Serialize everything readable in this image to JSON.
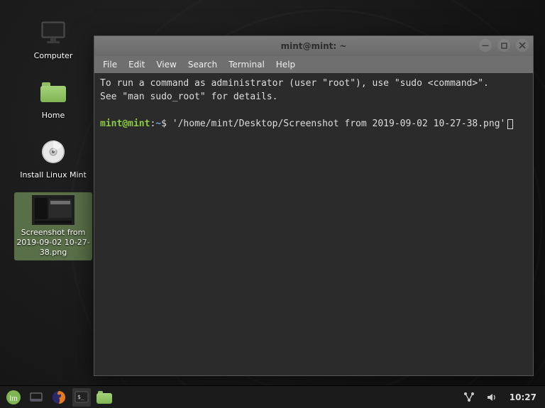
{
  "desktop": {
    "icons": [
      {
        "name": "computer",
        "label": "Computer"
      },
      {
        "name": "home",
        "label": "Home"
      },
      {
        "name": "install",
        "label": "Install Linux Mint"
      },
      {
        "name": "screenshot",
        "label": "Screenshot from 2019-09-02 10-27-38.png",
        "selected": true
      }
    ]
  },
  "terminal": {
    "title": "mint@mint: ~",
    "menu": [
      "File",
      "Edit",
      "View",
      "Search",
      "Terminal",
      "Help"
    ],
    "motd_line1": "To run a command as administrator (user \"root\"), use \"sudo <command>\".",
    "motd_line2": "See \"man sudo_root\" for details.",
    "prompt_user": "mint@mint",
    "prompt_sep": ":",
    "prompt_path": "~",
    "prompt_end": "$",
    "command": "'/home/mint/Desktop/Screenshot from 2019-09-02 10-27-38.png'",
    "buttons": {
      "minimize": "—",
      "maximize": "▢",
      "close": "✕"
    }
  },
  "taskbar": {
    "items": [
      {
        "name": "menu",
        "icon": "mint-logo"
      },
      {
        "name": "show-desktop",
        "icon": "desktop"
      },
      {
        "name": "firefox",
        "icon": "firefox"
      },
      {
        "name": "terminal",
        "icon": "terminal",
        "active": true
      },
      {
        "name": "files",
        "icon": "folder"
      }
    ],
    "tray": {
      "network": "network-icon",
      "sound": "sound-icon"
    },
    "clock": "10:27"
  },
  "colors": {
    "accent": "#8ccc3f",
    "path": "#6aa7e0",
    "window_bg": "#2b2b2b"
  }
}
